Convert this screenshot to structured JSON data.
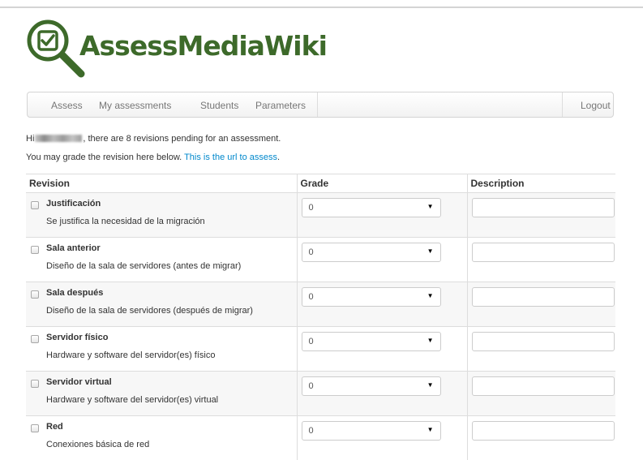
{
  "app": {
    "name": "AssessMediaWiki"
  },
  "navbar": {
    "items": [
      {
        "label": "Assess"
      },
      {
        "label": "My assessments"
      },
      {
        "label": "Students"
      },
      {
        "label": "Parameters"
      }
    ],
    "logout_label": "Logout"
  },
  "messages": {
    "greeting_prefix": "Hi",
    "greeting_suffix": ", there are 8 revisions pending for an assessment.",
    "grade_prefix": "You may grade the revision here below. ",
    "grade_link": "This is the url to assess",
    "grade_suffix": "."
  },
  "table": {
    "headers": {
      "revision": "Revision",
      "grade": "Grade",
      "description": "Description"
    },
    "rows": [
      {
        "title": "Justificación",
        "description": "Se justifica la necesidad de la migración",
        "grade": "0",
        "note": ""
      },
      {
        "title": "Sala anterior",
        "description": "Diseño de la sala de servidores (antes de migrar)",
        "grade": "0",
        "note": ""
      },
      {
        "title": "Sala después",
        "description": "Diseño de la sala de servidores (después de migrar)",
        "grade": "0",
        "note": ""
      },
      {
        "title": "Servidor físico",
        "description": "Hardware y software del servidor(es) físico",
        "grade": "0",
        "note": ""
      },
      {
        "title": "Servidor virtual",
        "description": "Hardware y software del servidor(es) virtual",
        "grade": "0",
        "note": ""
      },
      {
        "title": "Red",
        "description": "Conexiones básica de red",
        "grade": "0",
        "note": ""
      }
    ]
  },
  "colors": {
    "brand": "#3d6a2a",
    "link": "#0088cc"
  },
  "icons": {
    "logo": "magnifier-checkbox-icon",
    "select_arrow": "caret-down-icon"
  }
}
